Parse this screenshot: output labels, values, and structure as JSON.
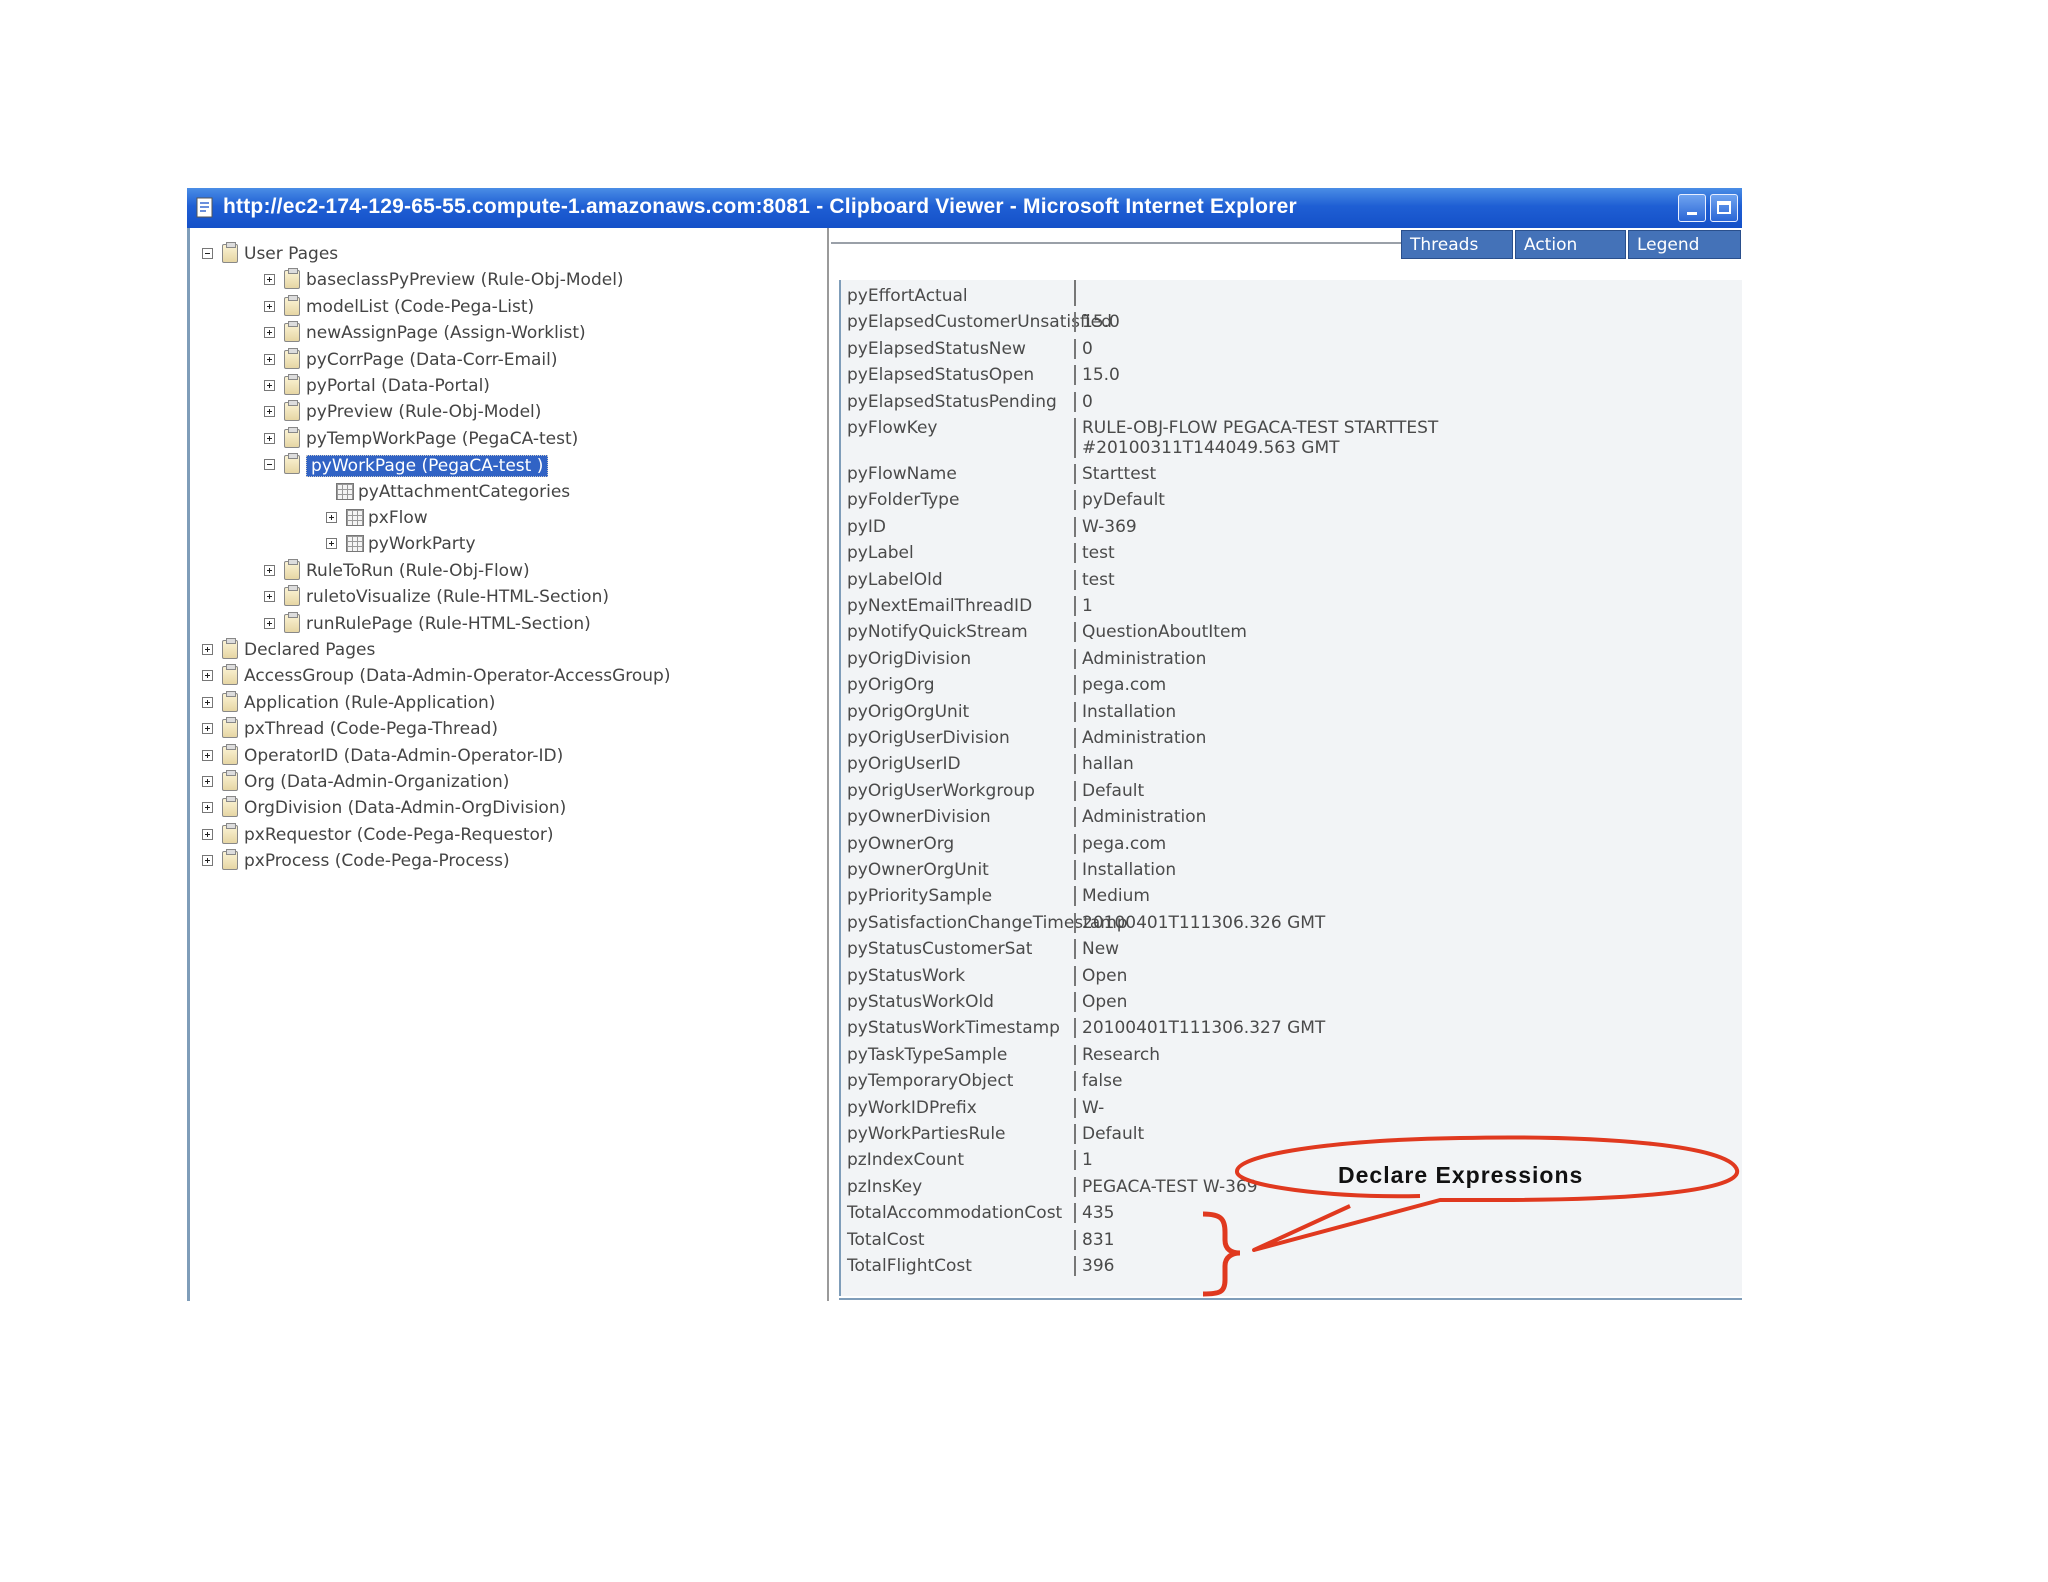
{
  "window": {
    "title": "http://ec2-174-129-65-55.compute-1.amazonaws.com:8081 - Clipboard Viewer - Microsoft Internet Explorer"
  },
  "tabs": [
    "Threads",
    "Action",
    "Legend"
  ],
  "tree": [
    {
      "label": "User Pages",
      "level": 0,
      "expander": "minus",
      "icon": "folder"
    },
    {
      "label": "baseclassPyPreview (Rule-Obj-Model)",
      "level": 1,
      "expander": "plus",
      "icon": "folder"
    },
    {
      "label": "modelList (Code-Pega-List)",
      "level": 1,
      "expander": "plus",
      "icon": "folder"
    },
    {
      "label": "newAssignPage (Assign-Worklist)",
      "level": 1,
      "expander": "plus",
      "icon": "folder"
    },
    {
      "label": "pyCorrPage (Data-Corr-Email)",
      "level": 1,
      "expander": "plus",
      "icon": "folder"
    },
    {
      "label": "pyPortal (Data-Portal)",
      "level": 1,
      "expander": "plus",
      "icon": "folder"
    },
    {
      "label": "pyPreview (Rule-Obj-Model)",
      "level": 1,
      "expander": "plus",
      "icon": "folder"
    },
    {
      "label": "pyTempWorkPage (PegaCA-test)",
      "level": 1,
      "expander": "plus",
      "icon": "folder"
    },
    {
      "label": "pyWorkPage (PegaCA-test )",
      "level": 1,
      "expander": "minus",
      "icon": "folder",
      "selected": true
    },
    {
      "label": "pyAttachmentCategories",
      "level": 2,
      "expander": "none",
      "icon": "grid"
    },
    {
      "label": "pxFlow",
      "level": 2,
      "expander": "plus",
      "icon": "grid"
    },
    {
      "label": "pyWorkParty",
      "level": 2,
      "expander": "plus",
      "icon": "grid"
    },
    {
      "label": "RuleToRun (Rule-Obj-Flow)",
      "level": 1,
      "expander": "plus",
      "icon": "folder"
    },
    {
      "label": "ruletoVisualize (Rule-HTML-Section)",
      "level": 1,
      "expander": "plus",
      "icon": "folder"
    },
    {
      "label": "runRulePage (Rule-HTML-Section)",
      "level": 1,
      "expander": "plus",
      "icon": "folder"
    },
    {
      "label": "Declared Pages",
      "level": 0,
      "expander": "plus",
      "icon": "folder"
    },
    {
      "label": "AccessGroup (Data-Admin-Operator-AccessGroup)",
      "level": 0,
      "expander": "plus",
      "icon": "folder"
    },
    {
      "label": "Application (Rule-Application)",
      "level": 0,
      "expander": "plus",
      "icon": "folder"
    },
    {
      "label": "pxThread (Code-Pega-Thread)",
      "level": 0,
      "expander": "plus",
      "icon": "folder"
    },
    {
      "label": "OperatorID (Data-Admin-Operator-ID)",
      "level": 0,
      "expander": "plus",
      "icon": "folder"
    },
    {
      "label": "Org (Data-Admin-Organization)",
      "level": 0,
      "expander": "plus",
      "icon": "folder"
    },
    {
      "label": "OrgDivision (Data-Admin-OrgDivision)",
      "level": 0,
      "expander": "plus",
      "icon": "folder"
    },
    {
      "label": "pxRequestor (Code-Pega-Requestor)",
      "level": 0,
      "expander": "plus",
      "icon": "folder"
    },
    {
      "label": "pxProcess (Code-Pega-Process)",
      "level": 0,
      "expander": "plus",
      "icon": "folder"
    }
  ],
  "properties": [
    {
      "name": "pyEffortActual",
      "value": ""
    },
    {
      "name": "pyElapsedCustomerUnsatisfied",
      "value": "15.0"
    },
    {
      "name": "pyElapsedStatusNew",
      "value": "0"
    },
    {
      "name": "pyElapsedStatusOpen",
      "value": "15.0"
    },
    {
      "name": "pyElapsedStatusPending",
      "value": "0"
    },
    {
      "name": "pyFlowKey",
      "value": "RULE-OBJ-FLOW PEGACA-TEST STARTTEST\n#20100311T144049.563 GMT"
    },
    {
      "name": "pyFlowName",
      "value": "Starttest"
    },
    {
      "name": "pyFolderType",
      "value": "pyDefault"
    },
    {
      "name": "pyID",
      "value": "W-369"
    },
    {
      "name": "pyLabel",
      "value": "test"
    },
    {
      "name": "pyLabelOld",
      "value": "test"
    },
    {
      "name": "pyNextEmailThreadID",
      "value": "1"
    },
    {
      "name": "pyNotifyQuickStream",
      "value": "QuestionAboutItem"
    },
    {
      "name": "pyOrigDivision",
      "value": "Administration"
    },
    {
      "name": "pyOrigOrg",
      "value": "pega.com"
    },
    {
      "name": "pyOrigOrgUnit",
      "value": "Installation"
    },
    {
      "name": "pyOrigUserDivision",
      "value": "Administration"
    },
    {
      "name": "pyOrigUserID",
      "value": "hallan"
    },
    {
      "name": "pyOrigUserWorkgroup",
      "value": "Default"
    },
    {
      "name": "pyOwnerDivision",
      "value": "Administration"
    },
    {
      "name": "pyOwnerOrg",
      "value": "pega.com"
    },
    {
      "name": "pyOwnerOrgUnit",
      "value": "Installation"
    },
    {
      "name": "pyPrioritySample",
      "value": "Medium"
    },
    {
      "name": "pySatisfactionChangeTimestamp",
      "value": "20100401T111306.326 GMT"
    },
    {
      "name": "pyStatusCustomerSat",
      "value": "New"
    },
    {
      "name": "pyStatusWork",
      "value": "Open"
    },
    {
      "name": "pyStatusWorkOld",
      "value": "Open"
    },
    {
      "name": "pyStatusWorkTimestamp",
      "value": "20100401T111306.327 GMT"
    },
    {
      "name": "pyTaskTypeSample",
      "value": "Research"
    },
    {
      "name": "pyTemporaryObject",
      "value": "false"
    },
    {
      "name": "pyWorkIDPrefix",
      "value": "W-"
    },
    {
      "name": "pyWorkPartiesRule",
      "value": "Default"
    },
    {
      "name": "pzIndexCount",
      "value": "1"
    },
    {
      "name": "pzInsKey",
      "value": "PEGACA-TEST W-369"
    },
    {
      "name": "TotalAccommodationCost",
      "value": "435"
    },
    {
      "name": "TotalCost",
      "value": "831"
    },
    {
      "name": "TotalFlightCost",
      "value": "396"
    }
  ],
  "annotation": {
    "text": "Declare Expressions",
    "color": "#e0391f"
  },
  "colors": {
    "titlebar": "#1f5fd4",
    "tab": "#4472b8",
    "selection": "#3163c5",
    "grid_background": "#f2f4f6"
  }
}
